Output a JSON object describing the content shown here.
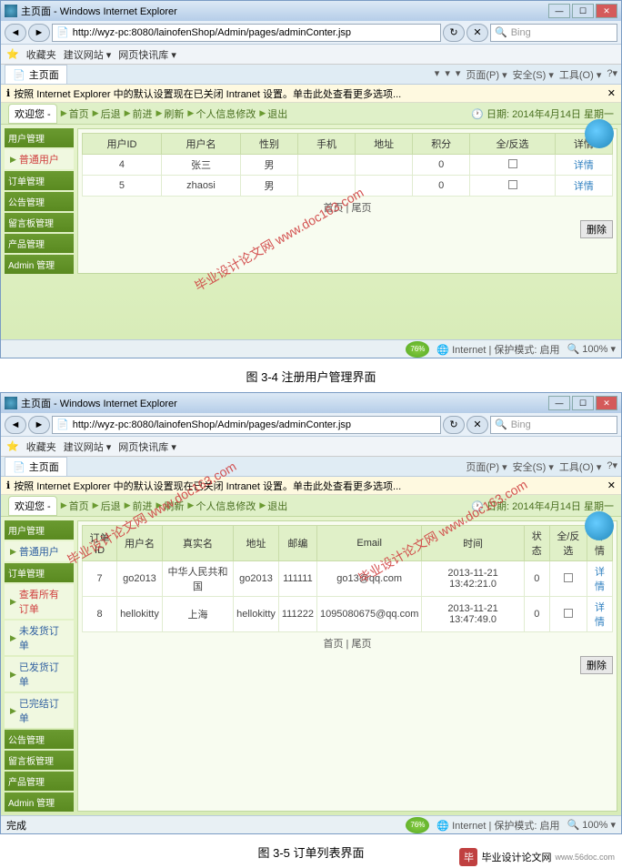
{
  "browser1": {
    "title": "主页面 - Windows Internet Explorer",
    "url": "http://wyz-pc:8080/lainofenShop/Admin/pages/adminConter.jsp",
    "search_placeholder": "Bing",
    "fav_label": "收藏夹",
    "fav_items": [
      "建议网站 ▾",
      "网页快讯库 ▾"
    ],
    "tab_title": "主页面",
    "tab_tools": [
      "▾",
      "▾",
      "▾",
      "页面(P) ▾",
      "安全(S) ▾",
      "工具(O) ▾",
      "?▾"
    ],
    "info_msg": "按照 Internet Explorer 中的默认设置现在已关闭 Intranet 设置。单击此处查看更多选项...",
    "welcome": "欢迎您 -",
    "topnav": [
      "首页",
      "后退",
      "前进",
      "刷新",
      "个人信息修改",
      "退出"
    ],
    "date": "日期: 2014年4月14日 星期一",
    "sidebar": [
      {
        "head": "用户管理",
        "items": [
          {
            "text": "普通用户",
            "red": true
          }
        ]
      },
      {
        "head": "订单管理"
      },
      {
        "head": "公告管理"
      },
      {
        "head": "留言板管理"
      },
      {
        "head": "产品管理"
      },
      {
        "head": "Admin 管理"
      }
    ],
    "table": {
      "headers": [
        "用户ID",
        "用户名",
        "性别",
        "手机",
        "地址",
        "积分",
        "全/反选",
        "详情"
      ],
      "rows": [
        {
          "id": "4",
          "name": "张三",
          "gender": "男",
          "phone": "",
          "addr": "",
          "score": "0",
          "detail": "详情"
        },
        {
          "id": "5",
          "name": "zhaosi",
          "gender": "男",
          "phone": "",
          "addr": "",
          "score": "0",
          "detail": "详情"
        }
      ],
      "pager": "首页 | 尾页",
      "del": "删除"
    },
    "status_left": "",
    "status_right": [
      "Internet | 保护模式: 启用",
      "100%"
    ],
    "caption": "图 3-4 注册用户管理界面"
  },
  "browser2": {
    "title": "主页面 - Windows Internet Explorer",
    "url": "http://wyz-pc:8080/lainofenShop/Admin/pages/adminConter.jsp",
    "search_placeholder": "Bing",
    "fav_label": "收藏夹",
    "fav_items": [
      "建议网站 ▾",
      "网页快讯库 ▾"
    ],
    "tab_title": "主页面",
    "tab_tools": [
      "▾",
      "▾",
      "▾",
      "页面(P) ▾",
      "安全(S) ▾",
      "工具(O) ▾",
      "?▾"
    ],
    "info_msg": "按照 Internet Explorer 中的默认设置现在已关闭 Intranet 设置。单击此处查看更多选项...",
    "welcome": "欢迎您 -",
    "topnav": [
      "首页",
      "后退",
      "前进",
      "刷新",
      "个人信息修改",
      "退出"
    ],
    "date": "日期: 2014年4月14日 星期一",
    "sidebar": [
      {
        "head": "用户管理",
        "items": [
          {
            "text": "普通用户",
            "red": false
          }
        ]
      },
      {
        "head": "订单管理",
        "items": [
          {
            "text": "查看所有订单",
            "red": true
          },
          {
            "text": "未发货订单",
            "red": false
          },
          {
            "text": "已发货订单",
            "red": false
          },
          {
            "text": "已完结订单",
            "red": false
          }
        ]
      },
      {
        "head": "公告管理"
      },
      {
        "head": "留言板管理"
      },
      {
        "head": "产品管理"
      },
      {
        "head": "Admin 管理"
      }
    ],
    "table": {
      "headers": [
        "订单ID",
        "用户名",
        "真实名",
        "地址",
        "邮编",
        "Email",
        "时间",
        "状态",
        "全/反选",
        "详情"
      ],
      "rows": [
        {
          "id": "7",
          "user": "go2013",
          "real": "中华人民共和国",
          "addr": "go2013",
          "zip": "111111",
          "email": "go13@qq.com",
          "time": "2013-11-21 13:42:21.0",
          "status": "0",
          "detail": "详情"
        },
        {
          "id": "8",
          "user": "hellokitty",
          "real": "上海",
          "addr": "hellokitty",
          "zip": "111222",
          "email": "1095080675@qq.com",
          "time": "2013-11-21 13:47:49.0",
          "status": "0",
          "detail": "详情"
        }
      ],
      "pager": "首页 | 尾页",
      "del": "删除"
    },
    "status_left": "完成",
    "status_right": [
      "Internet | 保护模式: 启用",
      "100%"
    ],
    "caption": "图 3-5 订单列表界面"
  },
  "watermark": "毕业设计论文网 www.doc163.com",
  "footer": {
    "text": "毕业设计论文网",
    "url": "www.56doc.com"
  }
}
